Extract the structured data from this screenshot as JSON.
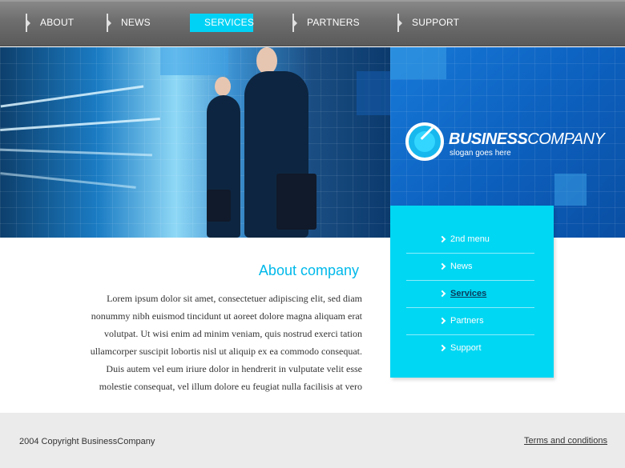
{
  "nav": {
    "items": [
      {
        "label": "ABOUT"
      },
      {
        "label": "NEWS"
      },
      {
        "label": "SERVICES",
        "active": true
      },
      {
        "label": "PARTNERS"
      },
      {
        "label": "SUPPORT"
      }
    ]
  },
  "brand": {
    "name_bold": "BUSINESS",
    "name_thin": "COMPANY",
    "slogan": "slogan goes here"
  },
  "side_menu": {
    "items": [
      {
        "label": "2nd menu"
      },
      {
        "label": "News"
      },
      {
        "label": "Services",
        "active": true
      },
      {
        "label": "Partners"
      },
      {
        "label": "Support"
      }
    ]
  },
  "content": {
    "title": "About company",
    "lines": [
      "Lorem ipsum dolor sit amet, consectetuer adipiscing elit, sed diam",
      "nonummy nibh euismod tincidunt ut aoreet dolore magna aliquam erat",
      "volutpat. Ut wisi enim ad minim veniam, quis nostrud exerci tation",
      "ullamcorper suscipit lobortis nisl ut aliquip ex ea commodo consequat.",
      "Duis autem vel eum iriure dolor in hendrerit in vulputate velit esse",
      "molestie consequat, vel illum dolore eu feugiat nulla facilisis at vero"
    ]
  },
  "footer": {
    "copyright": "2004 Copyright BusinessCompany",
    "terms": "Terms and conditions"
  },
  "colors": {
    "accent": "#00d7f3",
    "title": "#00b9ea",
    "nav_bg": "#6e6e6e",
    "panel_blue": "#0c5fbd",
    "footer_bg": "#ebebeb"
  }
}
